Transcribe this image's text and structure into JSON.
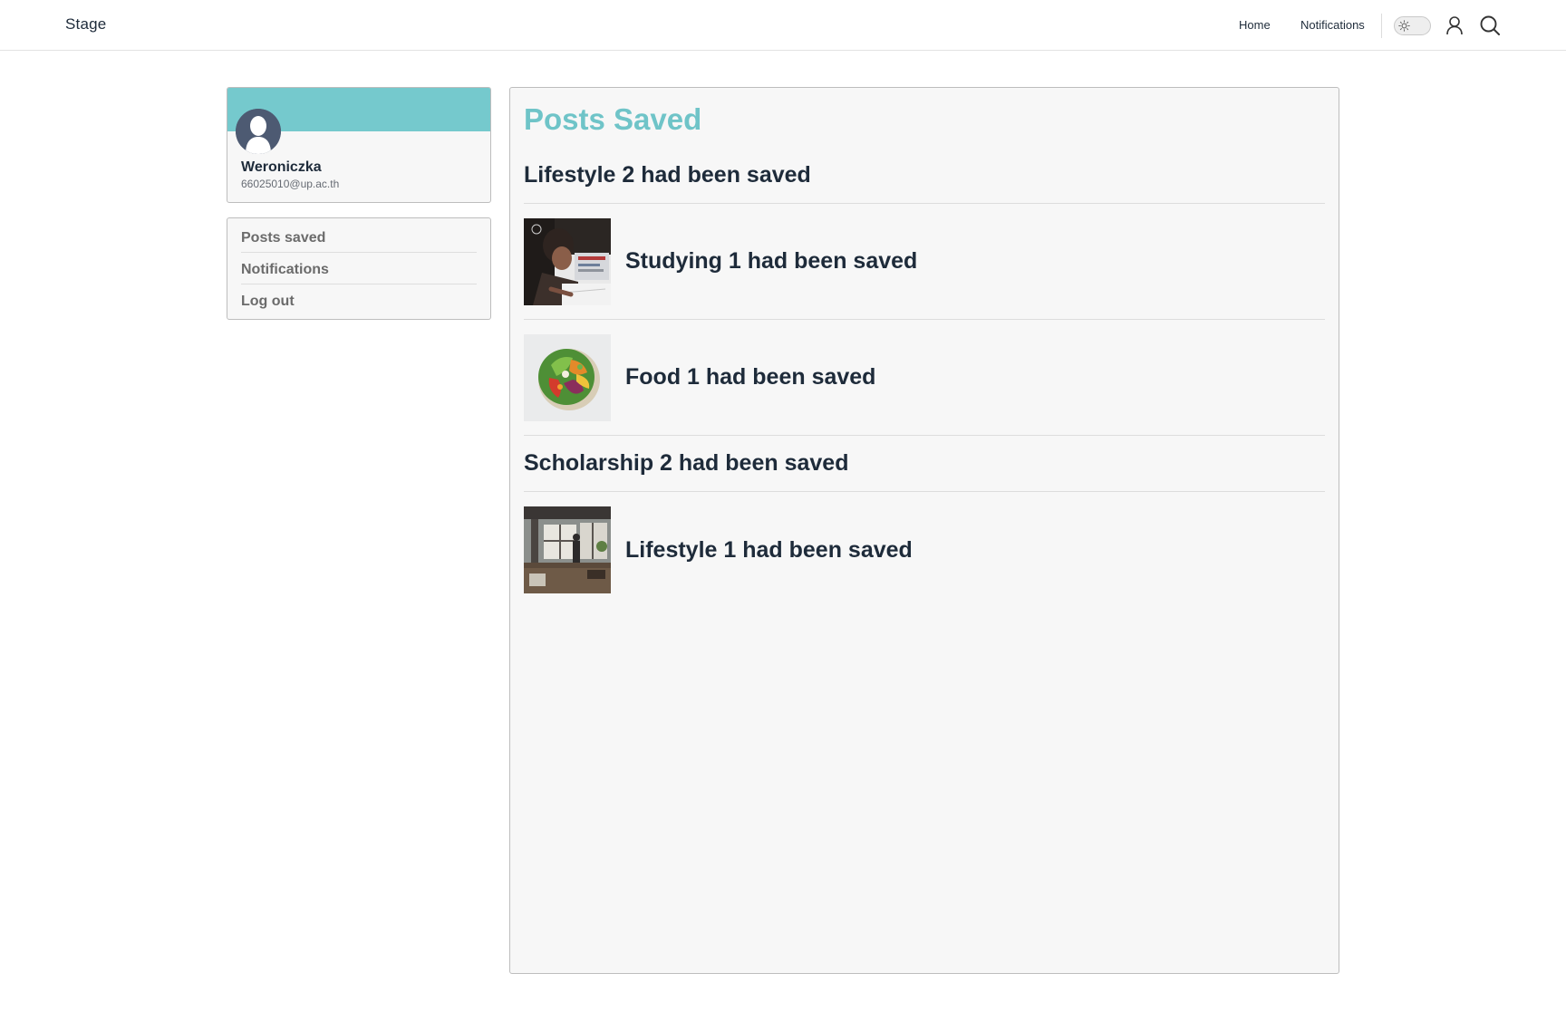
{
  "header": {
    "brand": "Stage",
    "nav": {
      "home": "Home",
      "notifications": "Notifications"
    },
    "icons": [
      "sun-icon",
      "user-icon",
      "search-icon"
    ]
  },
  "profile": {
    "name": "Weroniczka",
    "email": "66025010@up.ac.th",
    "banner_color": "#75c9cd"
  },
  "menu": {
    "items": [
      {
        "label": "Posts saved"
      },
      {
        "label": "Notifications"
      },
      {
        "label": "Log out"
      }
    ]
  },
  "main": {
    "title": "Posts Saved",
    "title_color": "#6fc4c8",
    "items": [
      {
        "type": "text",
        "label": "Lifestyle 2 had been saved"
      },
      {
        "type": "image",
        "label": "Studying 1 had been saved",
        "thumbnail": "studying-photo"
      },
      {
        "type": "image",
        "label": "Food 1 had been saved",
        "thumbnail": "food-bowl-photo"
      },
      {
        "type": "text",
        "label": "Scholarship 2 had been saved"
      },
      {
        "type": "image",
        "label": "Lifestyle 1 had been saved",
        "thumbnail": "room-interior-photo"
      }
    ]
  }
}
